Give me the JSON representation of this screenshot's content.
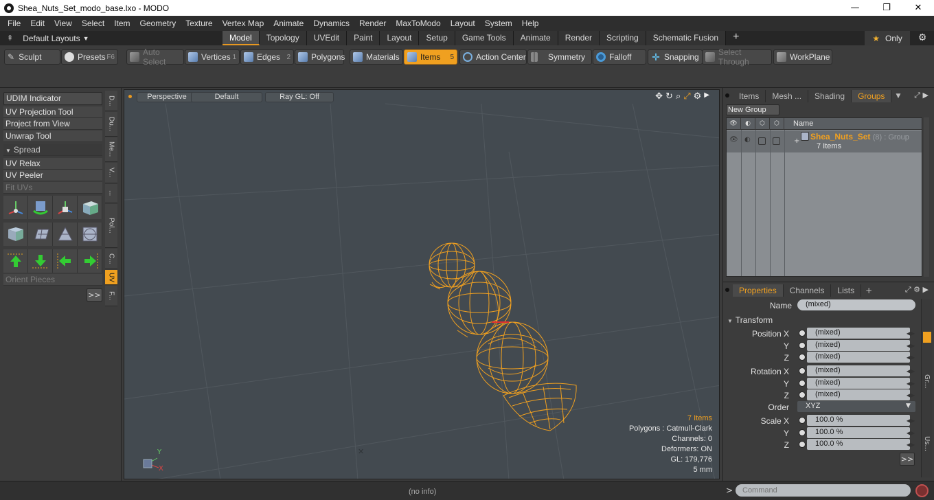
{
  "window": {
    "title": "Shea_Nuts_Set_modo_base.lxo - MODO",
    "min": "—",
    "restore": "❐",
    "close": "✕"
  },
  "menu": [
    "File",
    "Edit",
    "View",
    "Select",
    "Item",
    "Geometry",
    "Texture",
    "Vertex Map",
    "Animate",
    "Dynamics",
    "Render",
    "MaxToModo",
    "Layout",
    "System",
    "Help"
  ],
  "layouts": {
    "dropdown": "Default Layouts",
    "tabs": [
      "Model",
      "Topology",
      "UVEdit",
      "Paint",
      "Layout",
      "Setup",
      "Game Tools",
      "Animate",
      "Render",
      "Scripting",
      "Schematic Fusion"
    ],
    "active_tab": "Model",
    "plus": "+",
    "only": "Only"
  },
  "toolbar": {
    "sculpt": "Sculpt",
    "presets": "Presets",
    "presets_key": "F6",
    "auto_select": "Auto Select",
    "vertices": "Vertices",
    "vertices_key": "1",
    "edges": "Edges",
    "edges_key": "2",
    "polygons": "Polygons",
    "materials": "Materials",
    "items": "Items",
    "items_key": "5",
    "action_center": "Action Center",
    "symmetry": "Symmetry",
    "falloff": "Falloff",
    "snapping": "Snapping",
    "select_through": "Select Through",
    "workplane": "WorkPlane"
  },
  "left_panel": {
    "udim": "UDIM Indicator",
    "uv_projection": "UV Projection Tool",
    "project_view": "Project from View",
    "unwrap": "Unwrap Tool",
    "spread": "Spread",
    "uv_relax": "UV Relax",
    "uv_peeler": "UV Peeler",
    "fit_uvs": "Fit UVs",
    "orient": "Orient Pieces",
    "more": ">>",
    "vtabs": [
      "D...",
      "Du...",
      "Me...",
      "V...",
      "...",
      "Pol...",
      "C...",
      "UV",
      "F..."
    ]
  },
  "viewport": {
    "view": "Perspective",
    "shading": "Default",
    "raygl": "Ray GL: Off",
    "info": {
      "items": "7 Items",
      "polygons": "Polygons : Catmull-Clark",
      "channels": "Channels: 0",
      "deformers": "Deformers: ON",
      "gl": "GL: 179,776",
      "scale": "5 mm"
    },
    "axis_y": "Y",
    "axis_x": "X",
    "colors": {
      "wire": "#f0a020",
      "bg": "#434a50"
    }
  },
  "groups_panel": {
    "tabs": [
      "Items",
      "Mesh ...",
      "Shading",
      "Groups"
    ],
    "active_tab": "Groups",
    "new_group": "New Group",
    "col_name": "Name",
    "group_name": "Shea_Nuts_Set",
    "group_meta": "(8) : Group",
    "group_items": "7 Items"
  },
  "properties": {
    "tabs": [
      "Properties",
      "Channels",
      "Lists"
    ],
    "active_tab": "Properties",
    "plus": "+",
    "name_label": "Name",
    "name_value": "(mixed)",
    "transform": "Transform",
    "position_x_label": "Position X",
    "rotation_x_label": "Rotation X",
    "y_label": "Y",
    "z_label": "Z",
    "pos_x": "(mixed)",
    "pos_y": "(mixed)",
    "pos_z": "(mixed)",
    "rot_x": "(mixed)",
    "rot_y": "(mixed)",
    "rot_z": "(mixed)",
    "order_label": "Order",
    "order_value": "XYZ",
    "scale_x_label": "Scale X",
    "scale_x": "100.0 %",
    "scale_y": "100.0 %",
    "scale_z": "100.0 %",
    "more": ">>",
    "side_tabs": [
      "Gr...",
      "Us..."
    ]
  },
  "status": {
    "info": "(no info)",
    "command_placeholder": "Command",
    "prompt": ">"
  }
}
